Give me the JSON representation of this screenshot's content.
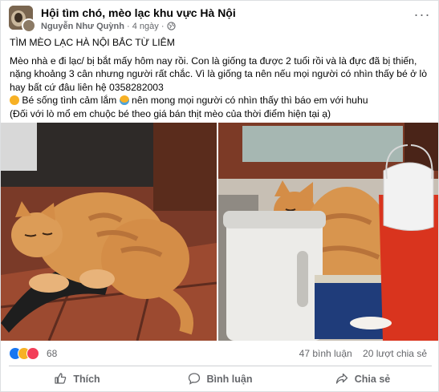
{
  "group": {
    "name": "Hội tìm chó, mèo lạc khu vực Hà Nội",
    "author": "Nguyễn Như Quỳnh",
    "time": "4 ngày",
    "separator": "·"
  },
  "post": {
    "title": "TÌM MÈO LẠC HÀ NỘI BẮC TỪ LIÊM",
    "lines": [
      "Mèo nhà e đi lạc/ bị bắt mấy hôm nay rồi. Con là giống ta được 2 tuổi rồi và là đực đã bị thiến,",
      "nặng khoảng 3 cân nhưng người rất chắc. Vì là giống ta nên nếu mọi người có nhìn thấy bé ở lò",
      "hay bất cứ đâu liên hệ 0358282003"
    ],
    "line_emoji_a": "Bé sống tình cảm lắm",
    "line_emoji_b": "nên mong mọi người có nhìn thấy thì báo em với huhu",
    "line_last": "(Đối với lò mổ em chuộc bé theo giá bán thịt mèo của thời điểm hiện tại ạ)"
  },
  "photos": [
    {
      "alt": "orange-tabby-cat-sleeping-on-floor"
    },
    {
      "alt": "orange-tabby-cat-behind-water-heater"
    }
  ],
  "stats": {
    "reactions": "68",
    "comments": "47 bình luận",
    "shares": "20 lượt chia sẻ"
  },
  "actions": {
    "like": "Thích",
    "comment": "Bình luận",
    "share": "Chia sẻ"
  },
  "colors": {
    "like_blue": "#1877f2",
    "care_yellow": "#f7b125",
    "love_red": "#f33e58",
    "text_secondary": "#65676b"
  }
}
